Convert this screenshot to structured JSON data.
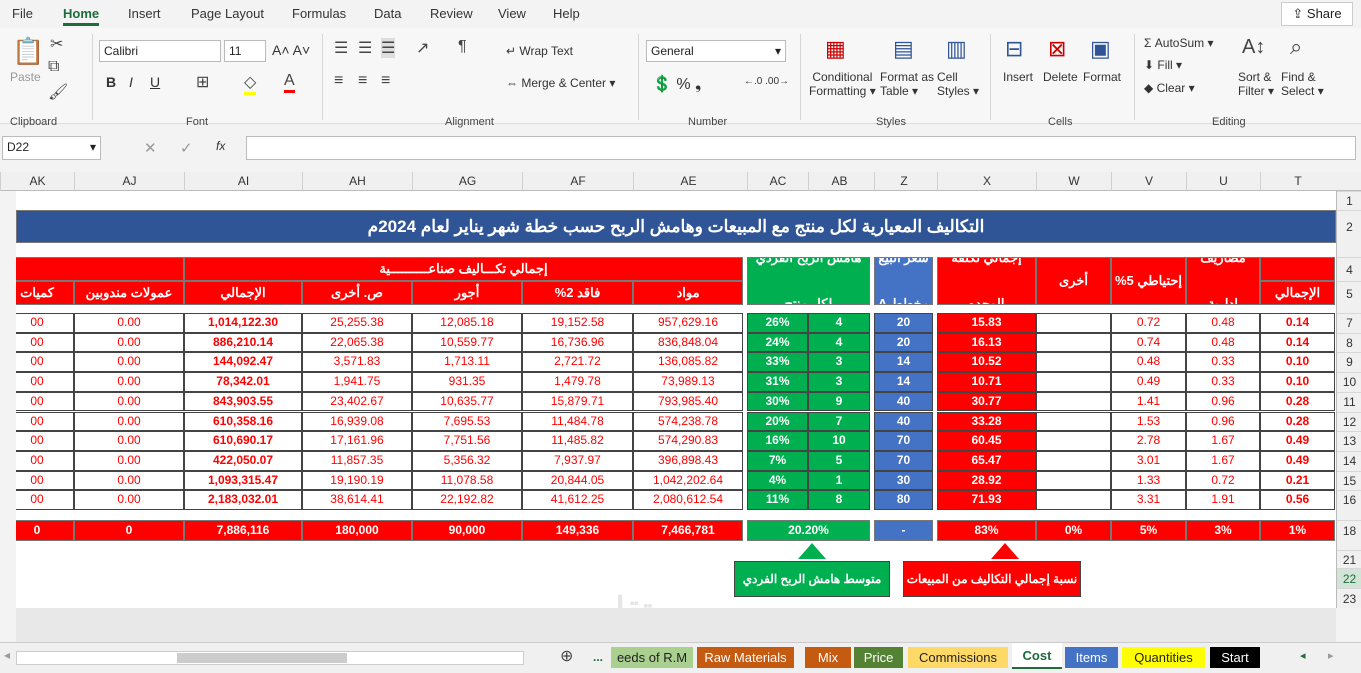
{
  "menu": {
    "items": [
      "File",
      "Home",
      "Insert",
      "Page Layout",
      "Formulas",
      "Data",
      "Review",
      "View",
      "Help"
    ],
    "active": "Home",
    "share": "Share"
  },
  "ribbon": {
    "clipboard": {
      "paste": "Paste",
      "group": "Clipboard"
    },
    "font": {
      "name": "Calibri",
      "size": "11",
      "group": "Font"
    },
    "alignment": {
      "wrap": "Wrap Text",
      "merge": "Merge & Center",
      "group": "Alignment"
    },
    "number": {
      "format": "General",
      "group": "Number"
    },
    "styles": {
      "conditional": "Conditional",
      "conditional2": "Formatting",
      "format_table": "Format as",
      "format_table2": "Table",
      "cell_styles": "Cell",
      "cell_styles2": "Styles",
      "group": "Styles"
    },
    "cells": {
      "insert": "Insert",
      "delete": "Delete",
      "format": "Format",
      "group": "Cells"
    },
    "editing": {
      "autosum": "AutoSum",
      "fill": "Fill",
      "clear": "Clear",
      "sort": "Sort &",
      "sort2": "Filter",
      "find": "Find &",
      "find2": "Select",
      "group": "Editing"
    }
  },
  "formula_bar": {
    "name_box": "D22",
    "fx": "fx",
    "value": ""
  },
  "columns": [
    "T",
    "U",
    "V",
    "W",
    "X",
    "Z",
    "AB",
    "AC",
    "AE",
    "AF",
    "AG",
    "AH",
    "AI",
    "AJ",
    "AK"
  ],
  "rows": [
    "1",
    "2",
    "4",
    "5",
    "7",
    "8",
    "9",
    "10",
    "11",
    "12",
    "13",
    "14",
    "15",
    "16",
    "18",
    "21",
    "22",
    "23"
  ],
  "sheet": {
    "title": "التكاليف المعيارية لكل منتج مع المبيعات وهامش الربح حسب خطة شهر يناير لعام 2024م",
    "headers": {
      "T": "الإجمالي",
      "U": "مصاريف إدارية",
      "V": "إحتياطي 5%",
      "W": "أخرى",
      "X": "إجمالي تكلفة الوحده",
      "Z": "سعر البيع مخطط A",
      "AC": "هامش الربح الفردي لكل منتج",
      "group_industrial": "إجمالي تكـــاليف صناعــــــــــية",
      "AE": "مواد",
      "AF": "فاقد 2%",
      "AG": "أجور",
      "AH": "ص. أخرى",
      "AI": "الإجمالي",
      "AJ": "عمولات مندوبين",
      "AK": "كميات"
    },
    "data": {
      "T": [
        "0.14",
        "0.14",
        "0.10",
        "0.10",
        "0.28",
        "0.28",
        "0.49",
        "0.49",
        "0.21",
        "0.56"
      ],
      "U": [
        "0.48",
        "0.48",
        "0.33",
        "0.33",
        "0.96",
        "0.96",
        "1.67",
        "1.67",
        "0.72",
        "1.91"
      ],
      "V": [
        "0.72",
        "0.74",
        "0.48",
        "0.49",
        "1.41",
        "1.53",
        "2.78",
        "3.01",
        "1.33",
        "3.31"
      ],
      "W": [
        "",
        "",
        "",
        "",
        "",
        "",
        "",
        "",
        "",
        ""
      ],
      "X": [
        "15.83",
        "16.13",
        "10.52",
        "10.71",
        "30.77",
        "33.28",
        "60.45",
        "65.47",
        "28.92",
        "71.93"
      ],
      "Z": [
        "20",
        "20",
        "14",
        "14",
        "40",
        "40",
        "70",
        "70",
        "30",
        "80"
      ],
      "AB": [
        "4",
        "4",
        "3",
        "3",
        "9",
        "7",
        "10",
        "5",
        "1",
        "8"
      ],
      "AC": [
        "26%",
        "24%",
        "33%",
        "31%",
        "30%",
        "20%",
        "16%",
        "7%",
        "4%",
        "11%"
      ],
      "AE": [
        "957,629.16",
        "836,848.04",
        "136,085.82",
        "73,989.13",
        "793,985.40",
        "574,238.78",
        "574,290.83",
        "396,898.43",
        "1,042,202.64",
        "2,080,612.54"
      ],
      "AF": [
        "19,152.58",
        "16,736.96",
        "2,721.72",
        "1,479.78",
        "15,879.71",
        "11,484.78",
        "11,485.82",
        "7,937.97",
        "20,844.05",
        "41,612.25"
      ],
      "AG": [
        "12,085.18",
        "10,559.77",
        "1,713.11",
        "931.35",
        "10,635.77",
        "7,695.53",
        "7,751.56",
        "5,356.32",
        "11,078.58",
        "22,192.82"
      ],
      "AH": [
        "25,255.38",
        "22,065.38",
        "3,571.83",
        "1,941.75",
        "23,402.67",
        "16,939.08",
        "17,161.96",
        "11,857.35",
        "19,190.19",
        "38,614.41"
      ],
      "AI": [
        "1,014,122.30",
        "886,210.14",
        "144,092.47",
        "78,342.01",
        "843,903.55",
        "610,358.16",
        "610,690.17",
        "422,050.07",
        "1,093,315.47",
        "2,183,032.01"
      ],
      "AJ": [
        "0.00",
        "0.00",
        "0.00",
        "0.00",
        "0.00",
        "0.00",
        "0.00",
        "0.00",
        "0.00",
        "0.00"
      ],
      "AK": [
        "00",
        "00",
        "00",
        "00",
        "00",
        "00",
        "00",
        "00",
        "00",
        "00"
      ]
    },
    "totals": {
      "T": "1%",
      "U": "3%",
      "V": "5%",
      "W": "0%",
      "X": "83%",
      "Z": "-",
      "AC": "20.20%",
      "AE": "7,466,781",
      "AF": "149,336",
      "AG": "90,000",
      "AH": "180,000",
      "AI": "7,886,116",
      "AJ": "0",
      "AK": "0"
    },
    "notes": {
      "margin": "متوسط هامش الربح الفردي",
      "cost_ratio": "نسبة إجمالي التكاليف من المبيعات"
    },
    "watermark": "مستقل mostaql.com"
  },
  "tabs": {
    "items": [
      {
        "label": "eeds of R.M",
        "color": "#a9d08e",
        "text": "#222"
      },
      {
        "label": "Raw Materials",
        "color": "#c55a11",
        "text": "#fff"
      },
      {
        "label": "Mix",
        "color": "#c55a11",
        "text": "#fff"
      },
      {
        "label": "Price",
        "color": "#548235",
        "text": "#fff"
      },
      {
        "label": "Commissions",
        "color": "#ffd966",
        "text": "#222"
      },
      {
        "label": "Cost",
        "color": "#ffffff",
        "text": "#1e6b3c"
      },
      {
        "label": "Items",
        "color": "#4472c4",
        "text": "#fff"
      },
      {
        "label": "Quantities",
        "color": "#ffff00",
        "text": "#222"
      },
      {
        "label": "Start",
        "color": "#000000",
        "text": "#fff"
      }
    ],
    "active": "Cost",
    "more": "..."
  },
  "colors": {
    "red": "#ff0000",
    "green": "#00b050",
    "blue": "#4472c4",
    "title_bg": "#2f5597"
  }
}
